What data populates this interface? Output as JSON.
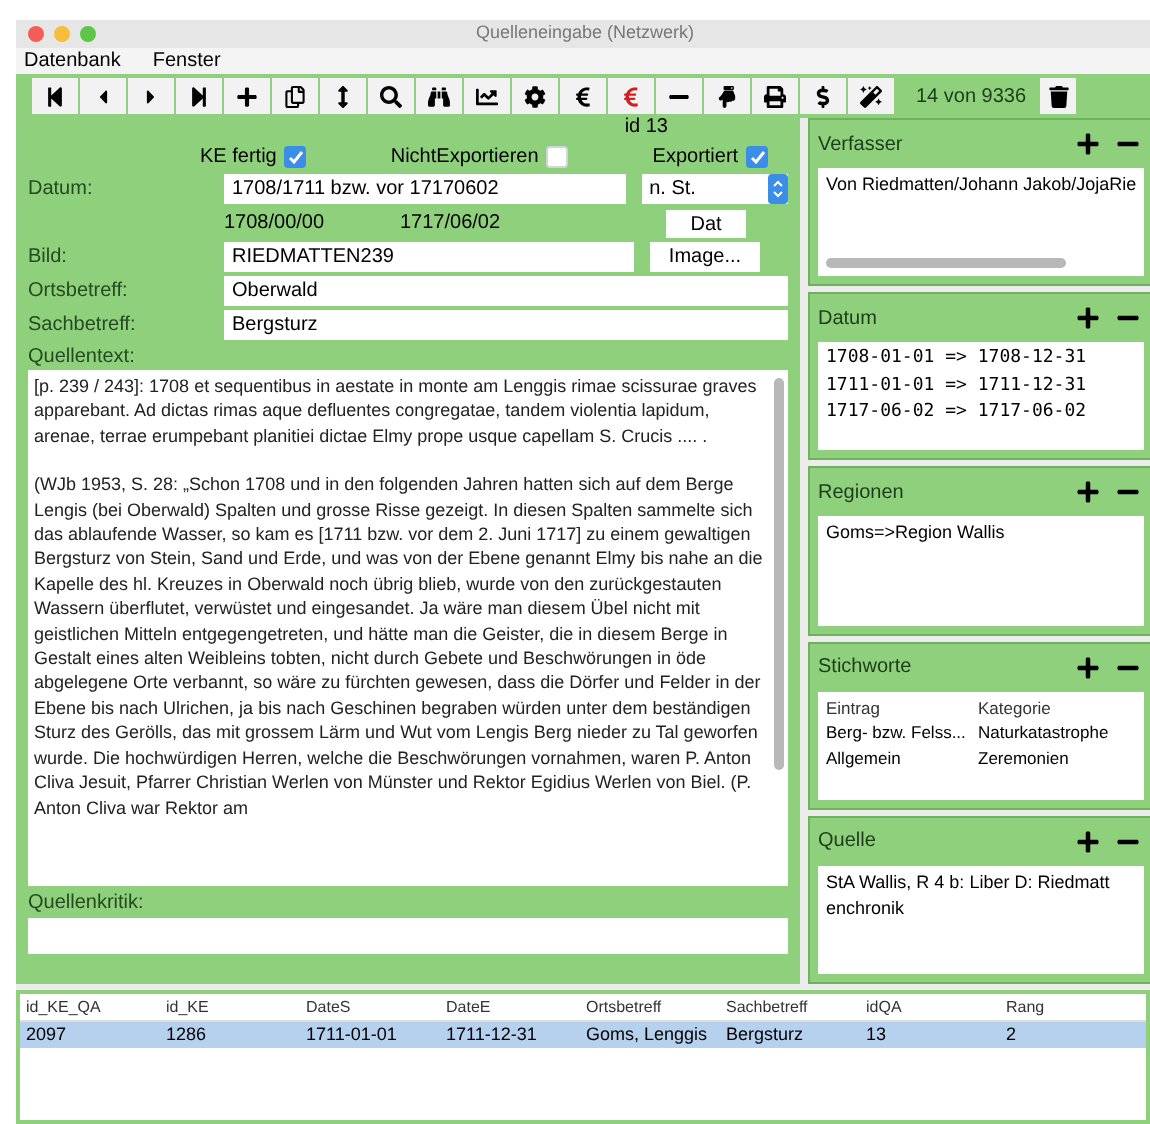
{
  "window": {
    "title": "Quelleneingabe (Netzwerk)"
  },
  "menu": [
    "Datenbank",
    "Fenster"
  ],
  "toolbar": {
    "tools": [
      {
        "kind": "first"
      },
      {
        "kind": "prev"
      },
      {
        "kind": "next"
      },
      {
        "kind": "last"
      },
      {
        "kind": "add"
      },
      {
        "kind": "copy"
      },
      {
        "kind": "sort"
      },
      {
        "kind": "search"
      },
      {
        "kind": "binoculars"
      },
      {
        "kind": "chart"
      },
      {
        "kind": "gear"
      },
      {
        "kind": "euro"
      },
      {
        "kind": "euro-red"
      },
      {
        "kind": "minus"
      },
      {
        "kind": "hand"
      },
      {
        "kind": "print"
      },
      {
        "kind": "dollar"
      },
      {
        "kind": "wand"
      }
    ],
    "counter": "14 von 9336"
  },
  "form": {
    "id": "id 13",
    "checks": [
      {
        "label": "KE fertig",
        "checked": true
      },
      {
        "label": "NichtExportieren",
        "checked": false
      },
      {
        "label": "Exportiert",
        "checked": true
      }
    ],
    "datum_label": "Datum:",
    "datum": "1708/1711 bzw. vor 17170602",
    "style": "n. St.",
    "date_start": "1708/00/00",
    "date_end": "1717/06/02",
    "dat_button": "Dat",
    "bild_label": "Bild:",
    "bild": "RIEDMATTEN239",
    "image_button": "Image...",
    "ort_label": "Ortsbetreff:",
    "ort": "Oberwald",
    "sach_label": "Sachbetreff:",
    "sach": "Bergsturz",
    "text_label": "Quellentext:",
    "text": [
      "[p. 239 / 243]: 1708 et sequentibus in aestate in monte am Lenggis rimae scissurae graves apparebant. Ad dictas rimas aque defluentes congregatae, tandem violentia lapidum, arenae, terrae erumpebant planitiei dictae Elmy prope usque capellam S. Crucis  .... .",
      "(WJb 1953, S. 28: „Schon 1708 und in den folgenden Jahren hatten sich auf dem Berge Lengis (bei Oberwald) Spalten und grosse Risse gezeigt. In diesen Spalten sammelte sich das ablaufende Wasser, so kam es [1711 bzw. vor dem 2. Juni 1717] zu einem gewaltigen Bergsturz von Stein, Sand und Erde, und was von der Ebene genannt Elmy bis nahe an die Kapelle des hl. Kreuzes in Oberwald noch übrig blieb, wurde von den zurückgestauten Wassern überflutet, verwüstet und eingesandet. Ja wäre man diesem Übel nicht mit geistlichen Mitteln entgegengetreten, und hätte man die Geister, die in diesem Berge in Gestalt eines alten Weibleins tobten, nicht durch Gebete und Beschwörungen in öde abgelegene Orte verbannt, so wäre zu fürchten gewesen, dass die Dörfer und Felder in der Ebene bis nach Ulrichen, ja bis nach Geschinen begraben würden unter dem beständigen Sturz des Gerölls, das mit grossem Lärm und Wut vom Lengis Berg nieder zu Tal geworfen wurde. Die hochwürdigen Herren, welche die Beschwörungen vornahmen, waren P. Anton Cliva Jesuit, Pfarrer Christian Werlen von Münster und Rektor Egidius Werlen von Biel. (P. Anton Cliva war Rektor am"
    ],
    "kritik_label": "Quellenkritik:"
  },
  "panels": [
    {
      "kind": "text",
      "title": "Verfasser",
      "lines": [
        "Von Riedmatten/Johann Jakob/JojaRie"
      ],
      "hscroll": true
    },
    {
      "kind": "text",
      "title": "Datum",
      "lines": [
        "1708-01-01 => 1708-12-31",
        "1711-01-01 => 1711-12-31",
        "1717-06-02 => 1717-06-02"
      ],
      "mono": true
    },
    {
      "kind": "text",
      "title": "Regionen",
      "lines": [
        "Goms=>Region Wallis"
      ]
    },
    {
      "kind": "table",
      "title": "Stichworte",
      "columns": [
        "Eintrag",
        "Kategorie"
      ],
      "rows": [
        [
          "Berg- bzw. Felss...",
          "Naturkatastrophe"
        ],
        [
          "Allgemein",
          "Zeremonien"
        ]
      ]
    },
    {
      "kind": "text",
      "title": "Quelle",
      "lines": [
        "StA Wallis, R 4 b: Liber D: Riedmatt",
        "enchronik"
      ]
    }
  ],
  "table": {
    "columns": [
      "id_KE_QA",
      "id_KE",
      "DateS",
      "DateE",
      "Ortsbetreff",
      "Sachbetreff",
      "idQA",
      "Rang"
    ],
    "rows": [
      {
        "selected": true,
        "cells": [
          "2097",
          "1286",
          "1711-01-01",
          "1711-12-31",
          "Goms, Lenggis",
          "Bergsturz",
          "13",
          "2"
        ]
      }
    ]
  }
}
